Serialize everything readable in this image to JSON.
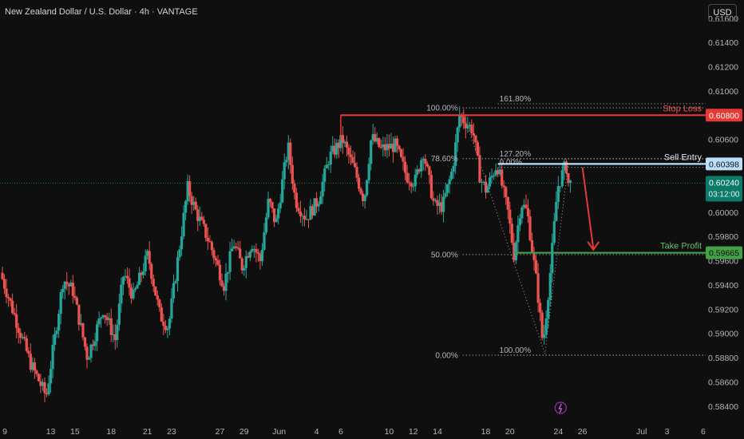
{
  "header": {
    "title": "New Zealand Dollar / U.S. Dollar · 4h · VANTAGE",
    "currency": "USD"
  },
  "colors": {
    "background": "#0f0f0f",
    "up": "#26a69a",
    "down": "#ef5350",
    "stop_loss": "#e53935",
    "sell_entry": "#bbdefb",
    "take_profit": "#43a047",
    "current_price_tag": "#0b7a68",
    "fib": "#9aa0a6"
  },
  "chart_data": {
    "type": "candlestick",
    "symbol": "NZD/USD",
    "timeframe": "4h",
    "ylim": [
      0.583,
      0.6175
    ],
    "y_ticks": [
      "0.61600",
      "0.61400",
      "0.61200",
      "0.61000",
      "0.60800",
      "0.60600",
      "0.60400",
      "0.60200",
      "0.60000",
      "0.59800",
      "0.59600",
      "0.59400",
      "0.59200",
      "0.59000",
      "0.58800",
      "0.58600",
      "0.58400"
    ],
    "x_ticks": [
      {
        "label": "9",
        "x": 0.2
      },
      {
        "label": "13",
        "x": 4
      },
      {
        "label": "15",
        "x": 6
      },
      {
        "label": "18",
        "x": 9
      },
      {
        "label": "21",
        "x": 12
      },
      {
        "label": "23",
        "x": 14
      },
      {
        "label": "27",
        "x": 18
      },
      {
        "label": "29",
        "x": 20
      },
      {
        "label": "Jun",
        "x": 22.9
      },
      {
        "label": "4",
        "x": 26
      },
      {
        "label": "6",
        "x": 28
      },
      {
        "label": "10",
        "x": 32
      },
      {
        "label": "12",
        "x": 34
      },
      {
        "label": "14",
        "x": 36
      },
      {
        "label": "18",
        "x": 40
      },
      {
        "label": "20",
        "x": 42
      },
      {
        "label": "24",
        "x": 46
      },
      {
        "label": "26",
        "x": 48
      },
      {
        "label": "Jul",
        "x": 52.9
      },
      {
        "label": "3",
        "x": 55
      },
      {
        "label": "6",
        "x": 58
      }
    ],
    "x_range": [
      -0.2,
      58.2
    ],
    "anchors": [
      [
        0.0,
        0.595
      ],
      [
        1.0,
        0.592
      ],
      [
        2.5,
        0.5875
      ],
      [
        3.8,
        0.5848
      ],
      [
        5.2,
        0.5945
      ],
      [
        6.0,
        0.5935
      ],
      [
        7.2,
        0.588
      ],
      [
        8.5,
        0.592
      ],
      [
        9.5,
        0.5895
      ],
      [
        10.2,
        0.595
      ],
      [
        11.0,
        0.593
      ],
      [
        12.2,
        0.5965
      ],
      [
        13.2,
        0.5915
      ],
      [
        13.9,
        0.5905
      ],
      [
        15.5,
        0.602
      ],
      [
        16.2,
        0.6
      ],
      [
        17.3,
        0.5975
      ],
      [
        18.5,
        0.594
      ],
      [
        19.3,
        0.5975
      ],
      [
        20.0,
        0.5955
      ],
      [
        20.8,
        0.5975
      ],
      [
        21.5,
        0.596
      ],
      [
        22.2,
        0.601
      ],
      [
        22.8,
        0.599
      ],
      [
        23.8,
        0.6055
      ],
      [
        24.4,
        0.601
      ],
      [
        25.3,
        0.5995
      ],
      [
        26.3,
        0.601
      ],
      [
        27.2,
        0.6045
      ],
      [
        28.3,
        0.606
      ],
      [
        29.3,
        0.6035
      ],
      [
        30.1,
        0.601
      ],
      [
        30.7,
        0.6062
      ],
      [
        31.5,
        0.6052
      ],
      [
        32.7,
        0.6055
      ],
      [
        33.6,
        0.603
      ],
      [
        34.3,
        0.6025
      ],
      [
        35.0,
        0.605
      ],
      [
        35.9,
        0.6005
      ],
      [
        36.6,
        0.6005
      ],
      [
        37.4,
        0.6035
      ],
      [
        38.0,
        0.608
      ],
      [
        38.4,
        0.6075
      ],
      [
        39.1,
        0.6068
      ],
      [
        39.7,
        0.6028
      ],
      [
        40.2,
        0.6018
      ],
      [
        41.1,
        0.604
      ],
      [
        42.0,
        0.6
      ],
      [
        42.5,
        0.5965
      ],
      [
        43.1,
        0.6008
      ],
      [
        43.6,
        0.6
      ],
      [
        44.4,
        0.594
      ],
      [
        44.9,
        0.589
      ],
      [
        45.5,
        0.595
      ],
      [
        46.1,
        0.602
      ],
      [
        46.8,
        0.604
      ],
      [
        47.0,
        0.6024
      ]
    ],
    "current_price": {
      "value": "0.60240",
      "countdown": "03:12:00",
      "y": 0.6024
    },
    "levels": [
      {
        "name": "Stop Loss",
        "label": "Stop Loss",
        "price_label": "0.60800",
        "y": 0.608,
        "x_from": 28.0
      },
      {
        "name": "Sell Entry",
        "label": "Sell Entry",
        "price_label": "0.60398",
        "y": 0.60398,
        "x_from": 41.0
      },
      {
        "name": "Take Profit",
        "label": "Take Profit",
        "price_label": "0.59665",
        "y": 0.59665,
        "x_from": 42.3
      }
    ],
    "fib_upper": {
      "x_from": 38.1,
      "x_to": 58.2,
      "levels": [
        {
          "label": "100.00%",
          "y": 0.6086
        },
        {
          "label": "78.60%",
          "y": 0.60442
        },
        {
          "label": "50.00%",
          "y": 0.5965
        },
        {
          "label": "0.00%",
          "y": 0.5882
        }
      ]
    },
    "fib_ext": {
      "x_from": 41.0,
      "x_to": 58.2,
      "levels": [
        {
          "label": "161.80%",
          "y": 0.60895
        },
        {
          "label": "127.20%",
          "y": 0.6044
        },
        {
          "label": "0.00%",
          "y": 0.6037
        },
        {
          "label": "100.00%",
          "y": 0.5882
        }
      ]
    },
    "arrow": {
      "x_from": 48.0,
      "y_from": 0.6037,
      "x_to": 48.9,
      "y_to": 0.5969
    }
  }
}
